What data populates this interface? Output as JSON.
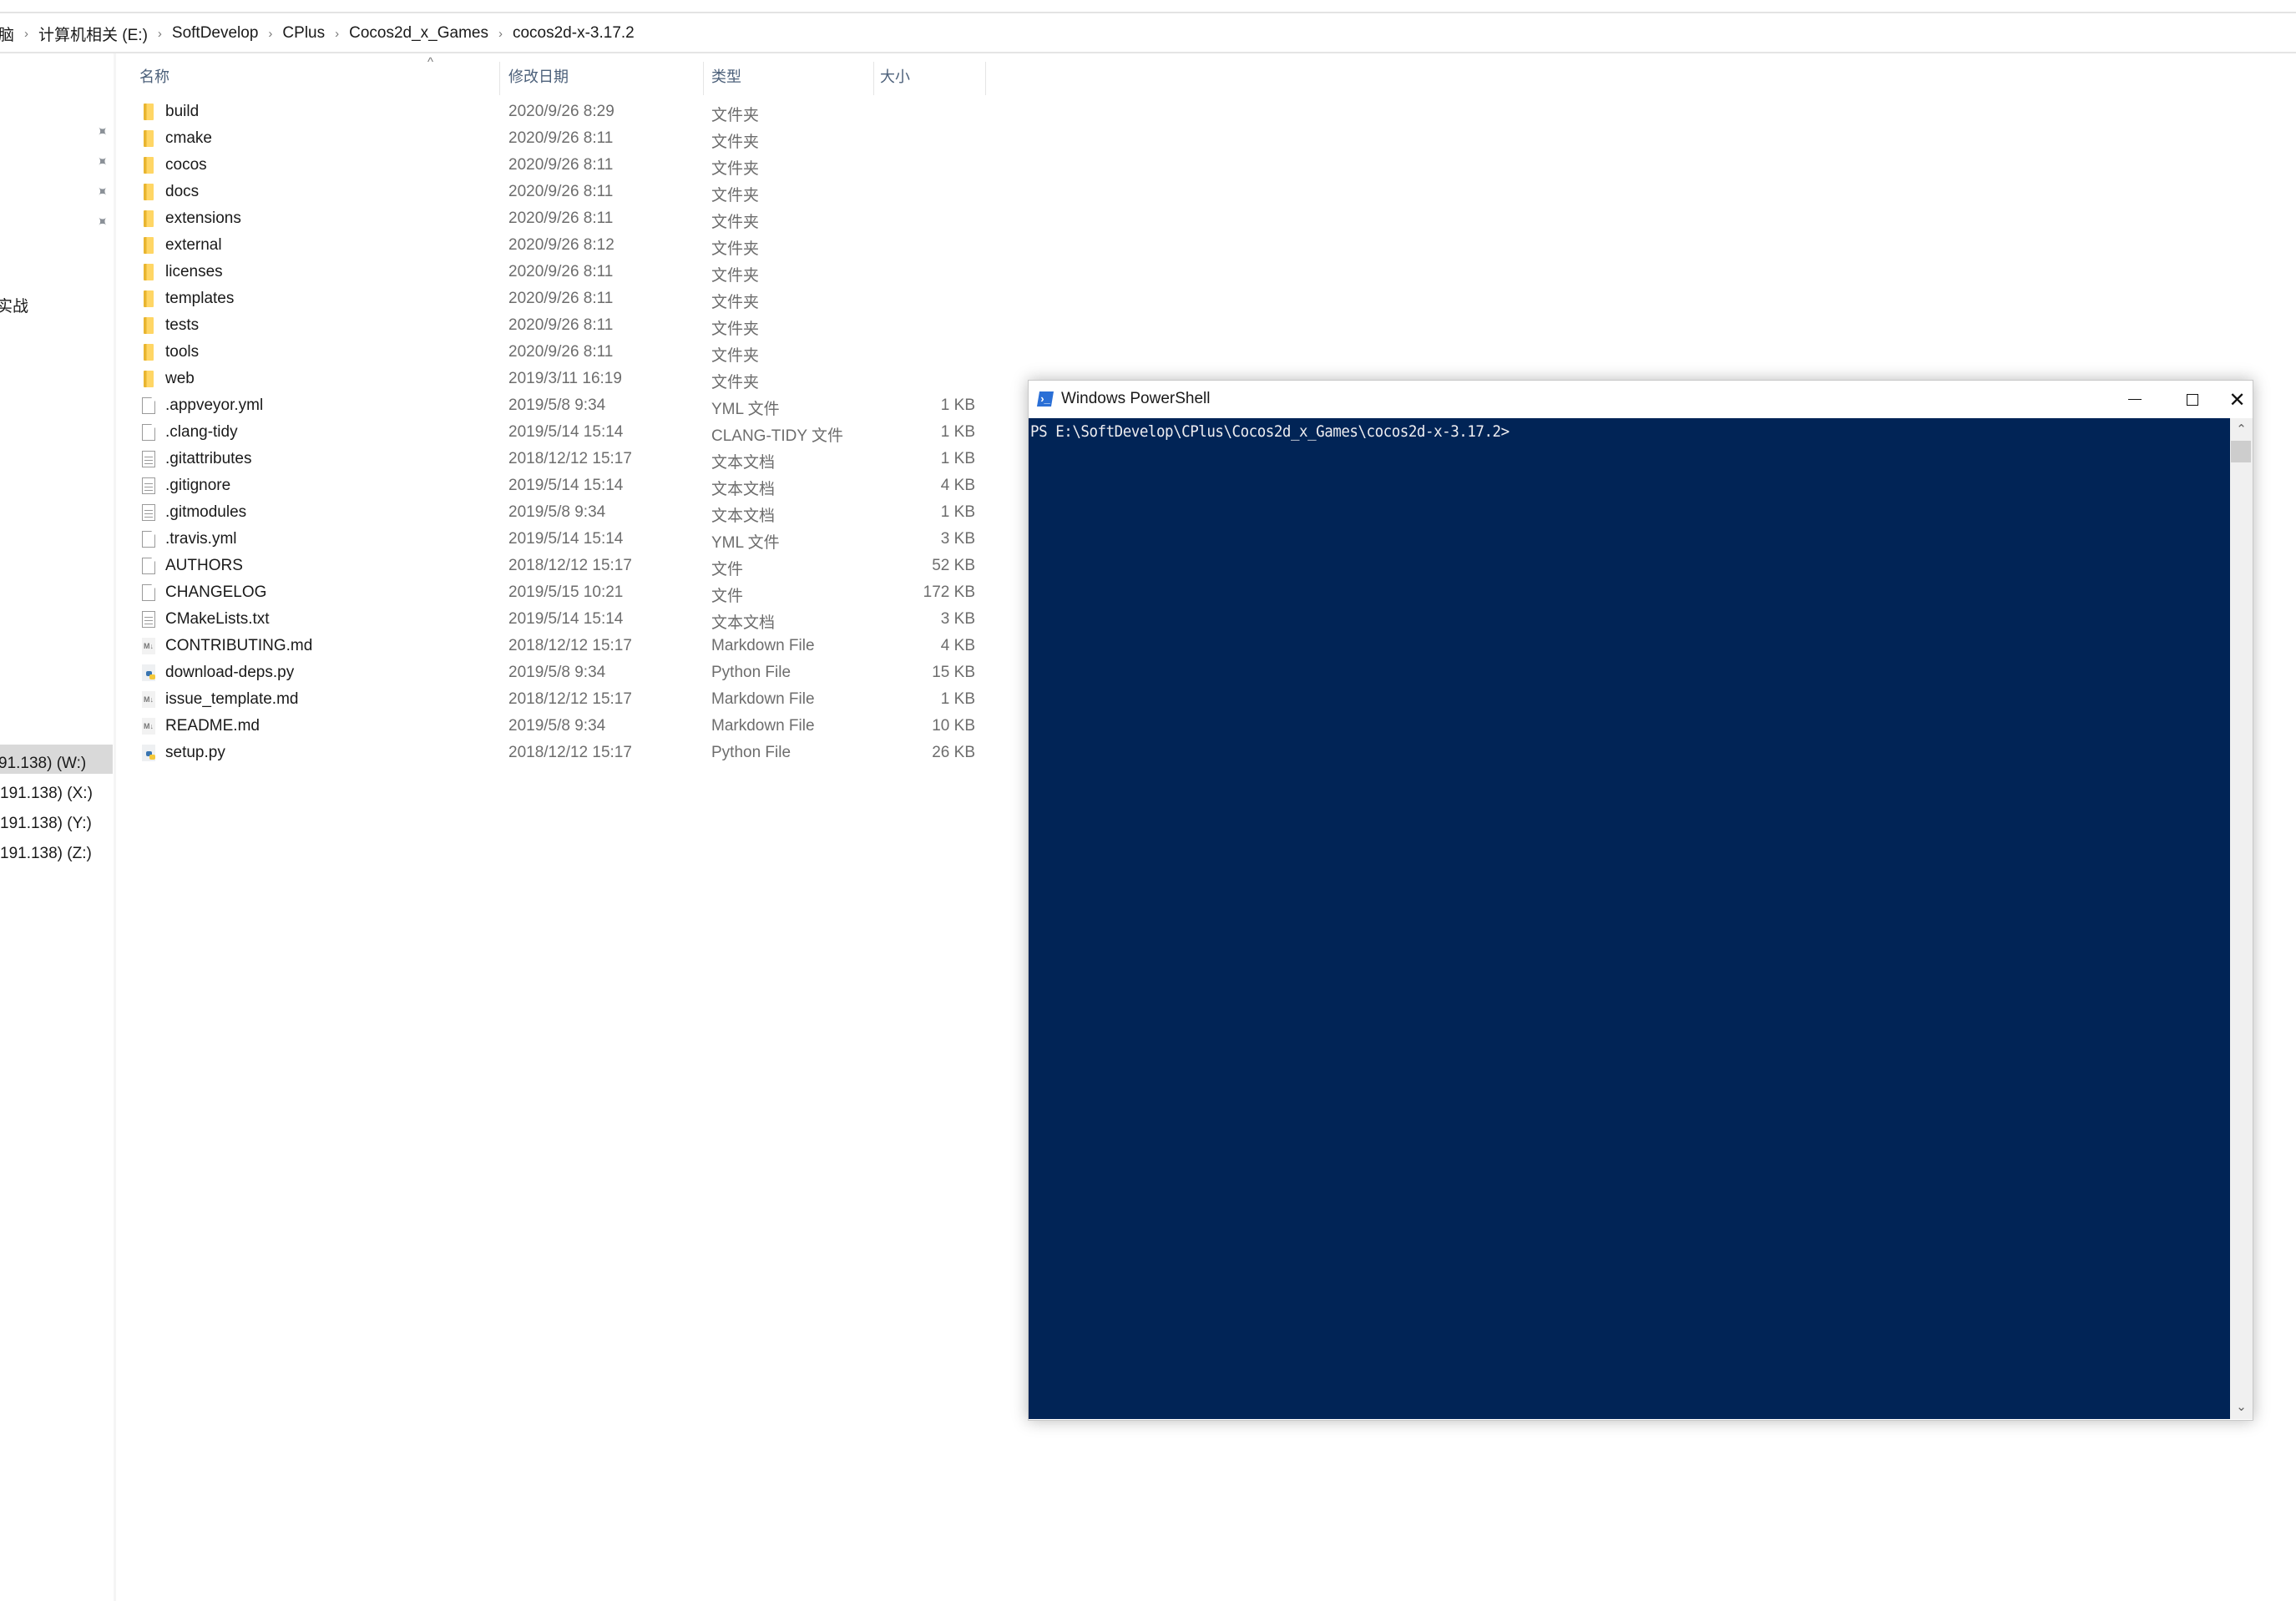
{
  "breadcrumb": {
    "items": [
      "脑",
      "计算机相关 (E:)",
      "SoftDevelop",
      "CPlus",
      "Cocos2d_x_Games",
      "cocos2d-x-3.17.2"
    ],
    "separator": "›"
  },
  "sidebar": {
    "pins": [
      "pin-icon",
      "pin-icon",
      "pin-icon",
      "pin-icon"
    ],
    "partial_item": "实战",
    "drives": [
      "91.138) (W:)",
      "191.138) (X:)",
      "191.138) (Y:)",
      "191.138) (Z:)"
    ]
  },
  "columns": {
    "name": "名称",
    "date": "修改日期",
    "type": "类型",
    "size": "大小",
    "sort_indicator": "^"
  },
  "files": [
    {
      "name": "build",
      "date": "2020/9/26 8:29",
      "type": "文件夹",
      "size": "",
      "icon": "folder"
    },
    {
      "name": "cmake",
      "date": "2020/9/26 8:11",
      "type": "文件夹",
      "size": "",
      "icon": "folder"
    },
    {
      "name": "cocos",
      "date": "2020/9/26 8:11",
      "type": "文件夹",
      "size": "",
      "icon": "folder"
    },
    {
      "name": "docs",
      "date": "2020/9/26 8:11",
      "type": "文件夹",
      "size": "",
      "icon": "folder"
    },
    {
      "name": "extensions",
      "date": "2020/9/26 8:11",
      "type": "文件夹",
      "size": "",
      "icon": "folder"
    },
    {
      "name": "external",
      "date": "2020/9/26 8:12",
      "type": "文件夹",
      "size": "",
      "icon": "folder"
    },
    {
      "name": "licenses",
      "date": "2020/9/26 8:11",
      "type": "文件夹",
      "size": "",
      "icon": "folder"
    },
    {
      "name": "templates",
      "date": "2020/9/26 8:11",
      "type": "文件夹",
      "size": "",
      "icon": "folder"
    },
    {
      "name": "tests",
      "date": "2020/9/26 8:11",
      "type": "文件夹",
      "size": "",
      "icon": "folder"
    },
    {
      "name": "tools",
      "date": "2020/9/26 8:11",
      "type": "文件夹",
      "size": "",
      "icon": "folder"
    },
    {
      "name": "web",
      "date": "2019/3/11 16:19",
      "type": "文件夹",
      "size": "",
      "icon": "folder"
    },
    {
      "name": ".appveyor.yml",
      "date": "2019/5/8 9:34",
      "type": "YML 文件",
      "size": "1 KB",
      "icon": "blank"
    },
    {
      "name": ".clang-tidy",
      "date": "2019/5/14 15:14",
      "type": "CLANG-TIDY 文件",
      "size": "1 KB",
      "icon": "blank"
    },
    {
      "name": ".gitattributes",
      "date": "2018/12/12 15:17",
      "type": "文本文档",
      "size": "1 KB",
      "icon": "text"
    },
    {
      "name": ".gitignore",
      "date": "2019/5/14 15:14",
      "type": "文本文档",
      "size": "4 KB",
      "icon": "text"
    },
    {
      "name": ".gitmodules",
      "date": "2019/5/8 9:34",
      "type": "文本文档",
      "size": "1 KB",
      "icon": "text"
    },
    {
      "name": ".travis.yml",
      "date": "2019/5/14 15:14",
      "type": "YML 文件",
      "size": "3 KB",
      "icon": "blank"
    },
    {
      "name": "AUTHORS",
      "date": "2018/12/12 15:17",
      "type": "文件",
      "size": "52 KB",
      "icon": "blank"
    },
    {
      "name": "CHANGELOG",
      "date": "2019/5/15 10:21",
      "type": "文件",
      "size": "172 KB",
      "icon": "blank"
    },
    {
      "name": "CMakeLists.txt",
      "date": "2019/5/14 15:14",
      "type": "文本文档",
      "size": "3 KB",
      "icon": "text"
    },
    {
      "name": "CONTRIBUTING.md",
      "date": "2018/12/12 15:17",
      "type": "Markdown File",
      "size": "4 KB",
      "icon": "markdown"
    },
    {
      "name": "download-deps.py",
      "date": "2019/5/8 9:34",
      "type": "Python File",
      "size": "15 KB",
      "icon": "python"
    },
    {
      "name": "issue_template.md",
      "date": "2018/12/12 15:17",
      "type": "Markdown File",
      "size": "1 KB",
      "icon": "markdown"
    },
    {
      "name": "README.md",
      "date": "2019/5/8 9:34",
      "type": "Markdown File",
      "size": "10 KB",
      "icon": "markdown"
    },
    {
      "name": "setup.py",
      "date": "2018/12/12 15:17",
      "type": "Python File",
      "size": "26 KB",
      "icon": "python"
    }
  ],
  "powershell": {
    "title": "Windows PowerShell",
    "logo_glyph": "›_",
    "prompt": "PS E:\\SoftDevelop\\CPlus\\Cocos2d_x_Games\\cocos2d-x-3.17.2>",
    "background_color": "#012456",
    "text_color": "#eeedf0",
    "scroll_position": 0
  },
  "icons": {
    "md_badge": "M↓",
    "pin": "📌",
    "scroll_up": "⌃",
    "scroll_down": "⌄",
    "close": "✕"
  }
}
